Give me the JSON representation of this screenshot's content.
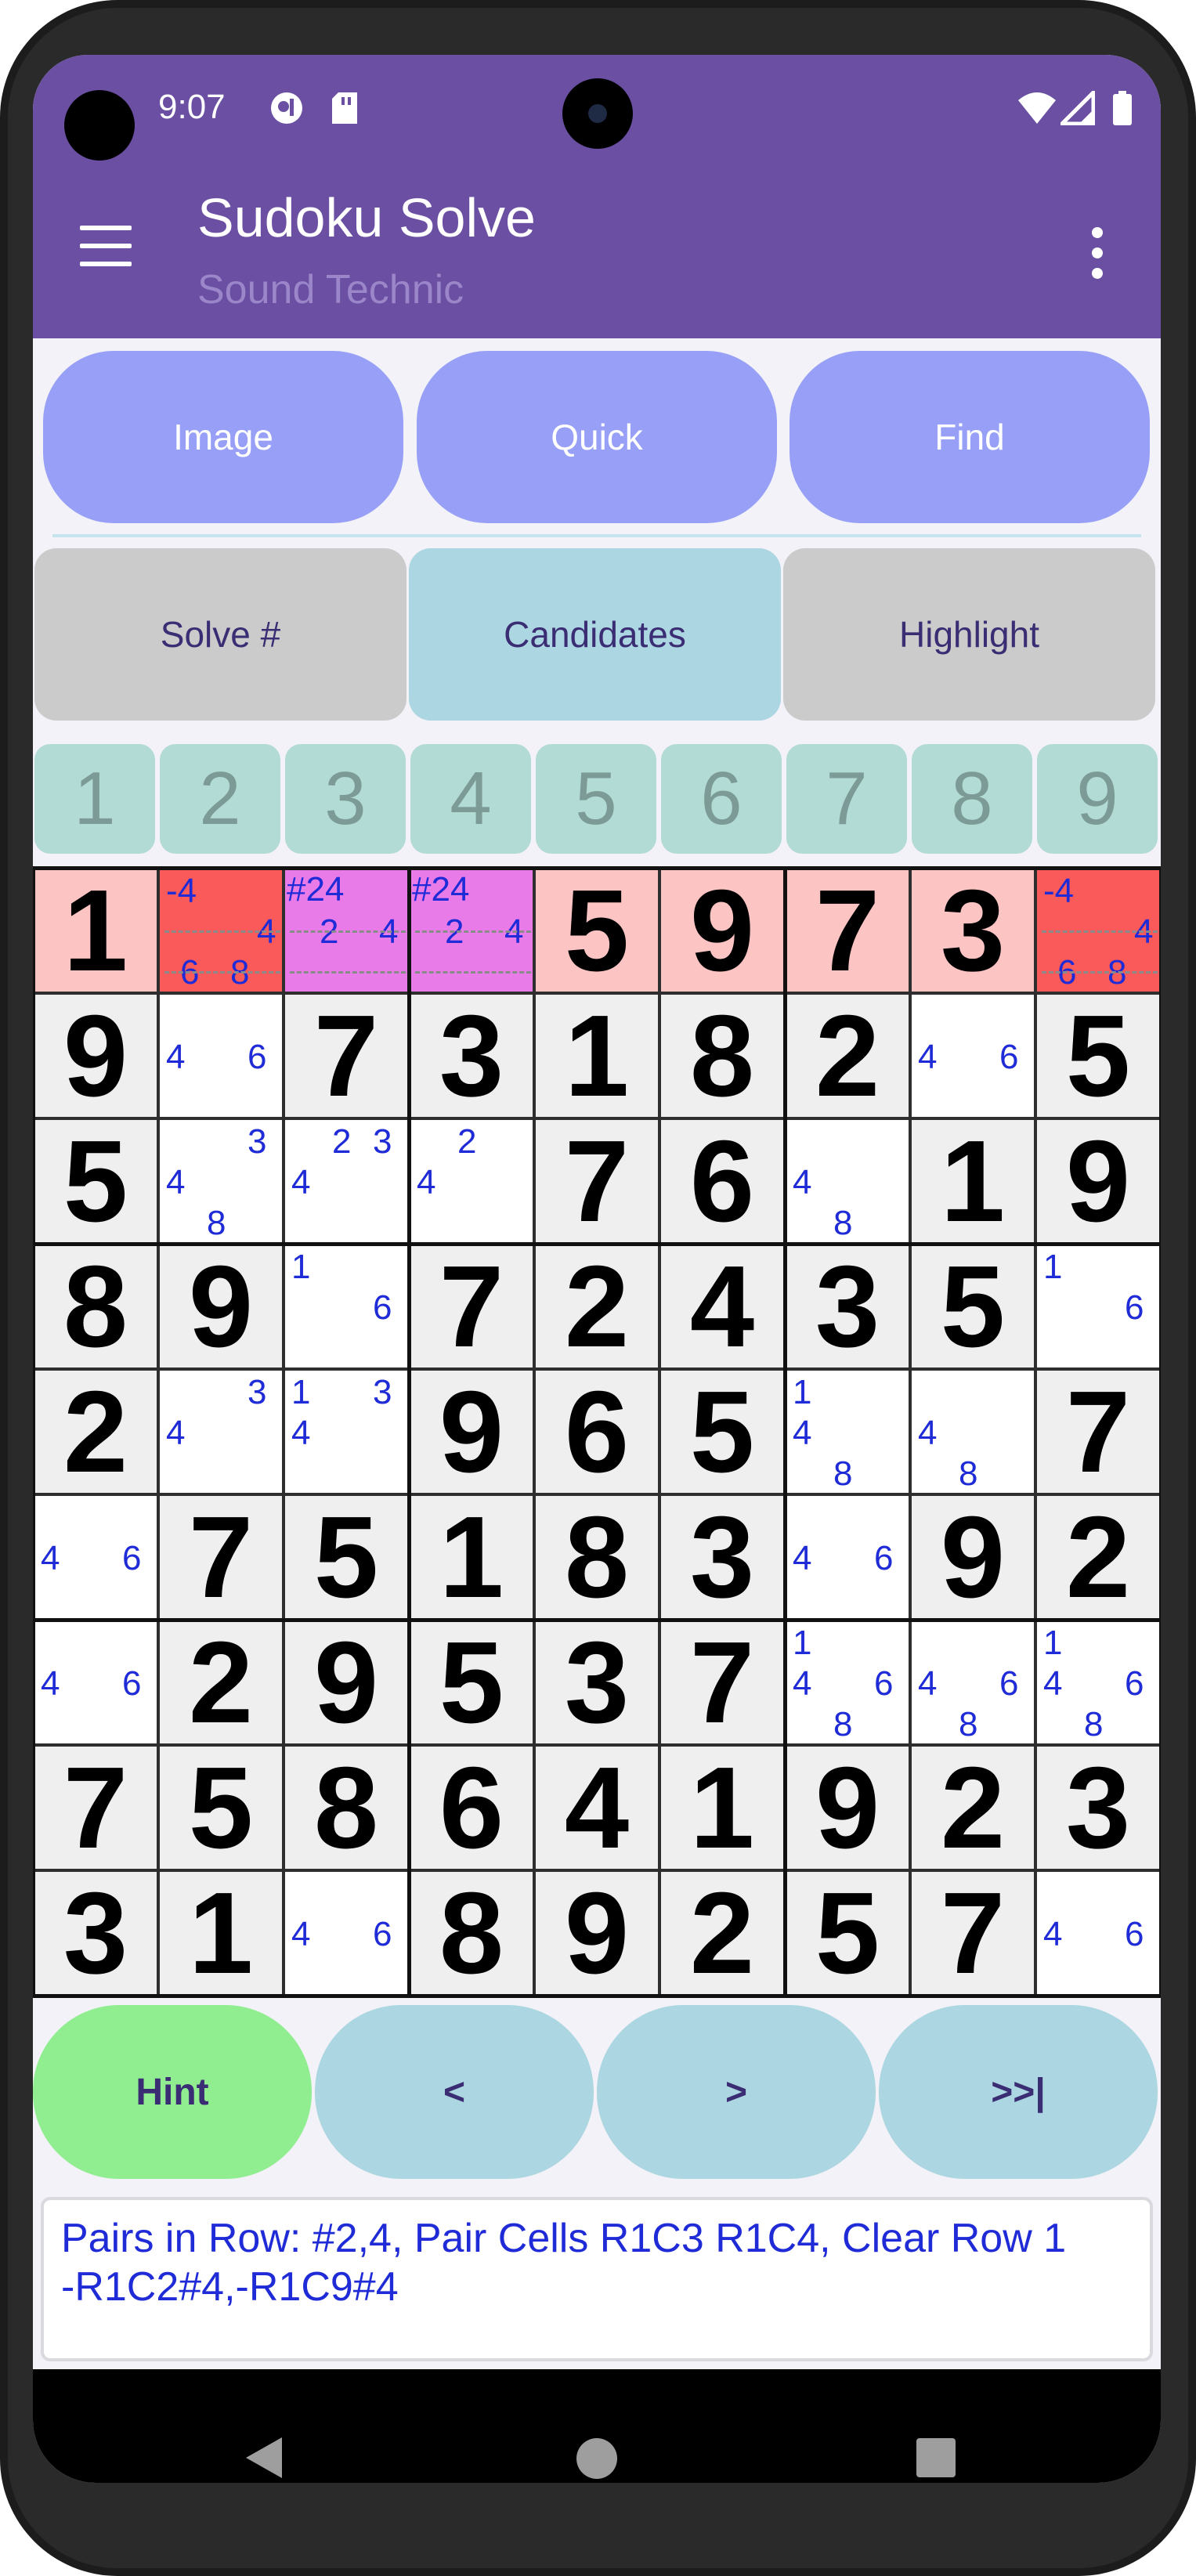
{
  "status": {
    "time": "9:07"
  },
  "app": {
    "title": "Sudoku Solve",
    "subtitle": "Sound Technic"
  },
  "top_buttons": [
    "Image",
    "Quick",
    "Find"
  ],
  "mode_buttons": [
    {
      "label": "Solve #",
      "active": false
    },
    {
      "label": "Candidates",
      "active": true
    },
    {
      "label": "Highlight",
      "active": false
    }
  ],
  "number_tabs": [
    "1",
    "2",
    "3",
    "4",
    "5",
    "6",
    "7",
    "8",
    "9"
  ],
  "colors": {
    "appbar": "#6a4fa3",
    "top_button": "#97a0f6",
    "mode_active": "#acd6e1",
    "mode_inactive": "#cbcbcb",
    "given_cell": "#efefef",
    "row_highlight": "#fdc4c4",
    "clear_cell": "#fb5a5a",
    "pair_cell": "#e87be8",
    "candidate": "#1f2bd6",
    "hint_button": "#90ee90",
    "nav_button": "#acd6e1"
  },
  "grid": [
    [
      {
        "v": "1",
        "bg": "row"
      },
      {
        "c": [
          " ",
          "-4",
          " ",
          " ",
          " ",
          "4",
          "6",
          "8"
        ],
        "bg": "clear"
      },
      {
        "c": [
          "#24",
          "2",
          "4"
        ],
        "bg": "pair"
      },
      {
        "c": [
          "#24",
          "2",
          "4"
        ],
        "bg": "pair"
      },
      {
        "v": "5",
        "bg": "row"
      },
      {
        "v": "9",
        "bg": "row"
      },
      {
        "v": "7",
        "bg": "row"
      },
      {
        "v": "3",
        "bg": "row"
      },
      {
        "c": [
          " ",
          "-4",
          " ",
          " ",
          " ",
          "4",
          "6",
          "8"
        ],
        "bg": "clear"
      }
    ],
    [
      {
        "v": "9"
      },
      {
        "c": [
          "4",
          "6"
        ]
      },
      {
        "v": "7"
      },
      {
        "v": "3"
      },
      {
        "v": "1"
      },
      {
        "v": "8"
      },
      {
        "v": "2"
      },
      {
        "c": [
          "4",
          "6"
        ]
      },
      {
        "v": "5"
      }
    ],
    [
      {
        "v": "5"
      },
      {
        "c": [
          "3",
          "4",
          "8"
        ]
      },
      {
        "c": [
          "2",
          "3",
          "4"
        ]
      },
      {
        "c": [
          "2",
          "4"
        ]
      },
      {
        "v": "7"
      },
      {
        "v": "6"
      },
      {
        "c": [
          "4",
          "8"
        ]
      },
      {
        "v": "1"
      },
      {
        "v": "9"
      }
    ],
    [
      {
        "v": "8"
      },
      {
        "v": "9"
      },
      {
        "c": [
          "1",
          "6"
        ]
      },
      {
        "v": "7"
      },
      {
        "v": "2"
      },
      {
        "v": "4"
      },
      {
        "v": "3"
      },
      {
        "v": "5"
      },
      {
        "c": [
          "1",
          "6"
        ]
      }
    ],
    [
      {
        "v": "2"
      },
      {
        "c": [
          "3",
          "4"
        ]
      },
      {
        "c": [
          "1",
          "3",
          "4"
        ]
      },
      {
        "v": "9"
      },
      {
        "v": "6"
      },
      {
        "v": "5"
      },
      {
        "c": [
          "1",
          "4",
          "8"
        ]
      },
      {
        "c": [
          "4",
          "8"
        ]
      },
      {
        "v": "7"
      }
    ],
    [
      {
        "c": [
          "4",
          "6"
        ]
      },
      {
        "v": "7"
      },
      {
        "v": "5"
      },
      {
        "v": "1"
      },
      {
        "v": "8"
      },
      {
        "v": "3"
      },
      {
        "c": [
          "4",
          "6"
        ]
      },
      {
        "v": "9"
      },
      {
        "v": "2"
      }
    ],
    [
      {
        "c": [
          "4",
          "6"
        ]
      },
      {
        "v": "2"
      },
      {
        "v": "9"
      },
      {
        "v": "5"
      },
      {
        "v": "3"
      },
      {
        "v": "7"
      },
      {
        "c": [
          "1",
          "4",
          "6",
          "8"
        ]
      },
      {
        "c": [
          "4",
          "6",
          "8"
        ]
      },
      {
        "c": [
          "1",
          "4",
          "6",
          "8"
        ]
      }
    ],
    [
      {
        "v": "7"
      },
      {
        "v": "5"
      },
      {
        "v": "8"
      },
      {
        "v": "6"
      },
      {
        "v": "4"
      },
      {
        "v": "1"
      },
      {
        "v": "9"
      },
      {
        "v": "2"
      },
      {
        "v": "3"
      }
    ],
    [
      {
        "v": "3"
      },
      {
        "v": "1"
      },
      {
        "c": [
          "4",
          "6"
        ]
      },
      {
        "v": "8"
      },
      {
        "v": "9"
      },
      {
        "v": "2"
      },
      {
        "v": "5"
      },
      {
        "v": "7"
      },
      {
        "c": [
          "4",
          "6"
        ]
      }
    ]
  ],
  "bottom_buttons": [
    {
      "label": "Hint",
      "color": "#90ee90"
    },
    {
      "label": "<",
      "color": "#acd6e1"
    },
    {
      "label": ">",
      "color": "#acd6e1"
    },
    {
      "label": ">>|",
      "color": "#acd6e1"
    }
  ],
  "message": {
    "line1": "Pairs in Row: #2,4, Pair Cells R1C3 R1C4, Clear Row 1",
    "line2": "-R1C2#4,-R1C9#4"
  }
}
